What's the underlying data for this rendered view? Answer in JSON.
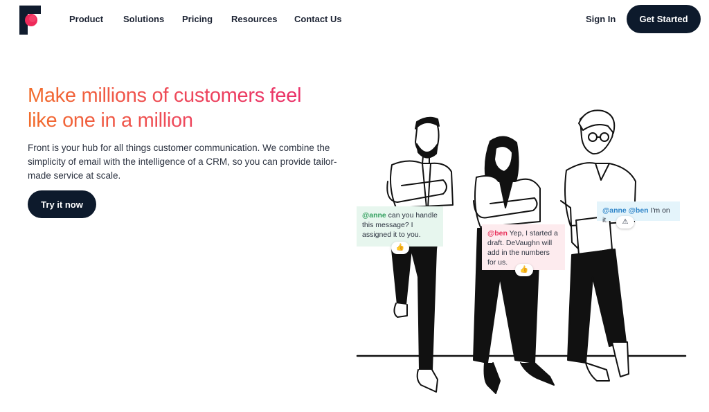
{
  "header": {
    "logo_icon": "front-logo-icon",
    "nav": [
      "Product",
      "Solutions",
      "Pricing",
      "Resources",
      "Contact Us"
    ],
    "sign_in": "Sign In",
    "cta": "Get Started"
  },
  "hero": {
    "headline_line1": "Make millions of customers feel",
    "headline_line2": "like one in a million",
    "subtext": "Front is your hub for all things customer communication. We combine the simplicity of email with the intelligence of a CRM, so you can provide tailor-made service at scale.",
    "cta": "Try it now"
  },
  "chat_bubbles": [
    {
      "mention": "@anne",
      "text": " can you handle this message? I assigned it to you.",
      "reaction": "👍"
    },
    {
      "mention": "@ben",
      "text": " Yep, I started a draft. DeVaughn will add in the numbers for us.",
      "reaction": "👍"
    },
    {
      "mention": "@anne @ben",
      "text": " I'm on it.",
      "reaction": "⚠"
    }
  ],
  "colors": {
    "navy": "#0d1a2c",
    "gradient_start": "#f26d2b",
    "gradient_end": "#e8246e",
    "bubble_green": "#e7f6ee",
    "bubble_pink": "#fdebee",
    "bubble_blue": "#e4f4fb"
  }
}
